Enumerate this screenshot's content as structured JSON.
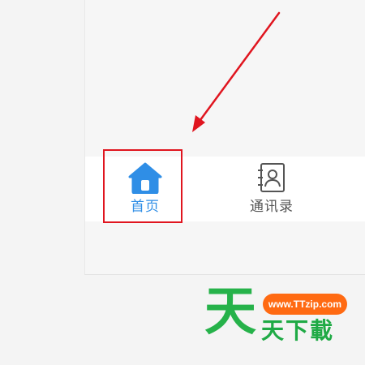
{
  "tabbar": {
    "tabs": [
      {
        "label": "首页",
        "icon": "home-icon",
        "active": true,
        "color": "#2f8ee6"
      },
      {
        "label": "通讯录",
        "icon": "contacts-icon",
        "active": false,
        "color": "#555555"
      }
    ]
  },
  "annotation": {
    "highlight_color": "#e0151f",
    "arrow_color": "#e0151f"
  },
  "watermark": {
    "big_char": "天",
    "url": "www.TTzip.com",
    "subtitle": "天下載",
    "brand_green": "#26b24a",
    "pill_color": "#ff6a12"
  }
}
